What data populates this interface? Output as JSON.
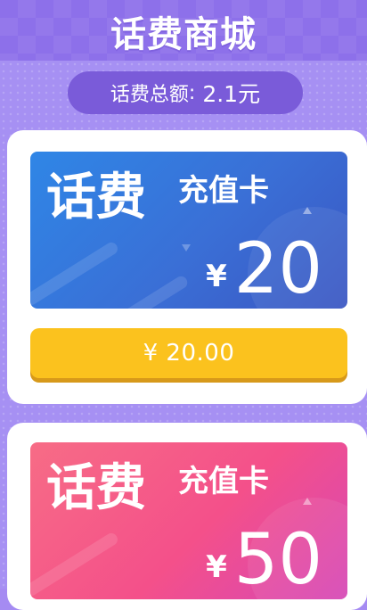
{
  "header": {
    "title": "话费商城"
  },
  "balance": {
    "label": "话费总额",
    "separator": ":",
    "amount": "2.1元"
  },
  "products": [
    {
      "title": "话费",
      "subtitle": "充值卡",
      "currency": "¥",
      "face_value": "20",
      "price_label": "¥ 20.00",
      "color_start": "#2f86e6",
      "color_end": "#3a56c2"
    },
    {
      "title": "话费",
      "subtitle": "充值卡",
      "currency": "¥",
      "face_value": "50",
      "color_start": "#f76c86",
      "color_end": "#d647b6"
    }
  ],
  "colors": {
    "page_background": "#a690f3",
    "header_background": "#8d70ea",
    "balance_pill": "#7a5bd9",
    "buy_button": "#fbc21e"
  }
}
